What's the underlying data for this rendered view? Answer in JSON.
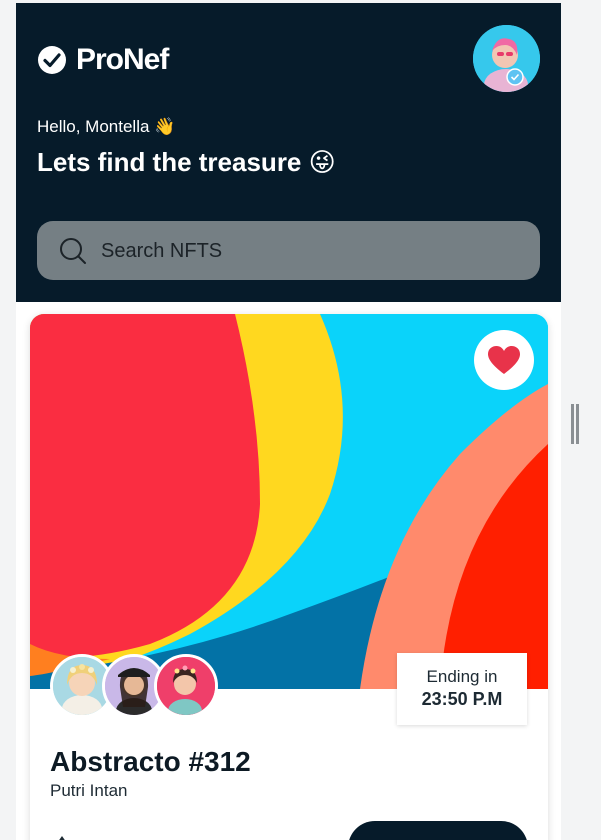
{
  "app": {
    "name": "ProNef"
  },
  "header": {
    "greeting": "Hello, Montella 👋",
    "headline": "Lets find the treasure 😜"
  },
  "search": {
    "placeholder": "Search NFTS",
    "value": ""
  },
  "nft_card": {
    "name": "Abstracto #312",
    "creator": "Putri Intan",
    "ending_label": "Ending in",
    "ending_time": "23:50 P.M",
    "liked": true
  },
  "colors": {
    "header_bg": "#061b2a",
    "search_bg": "#757f84",
    "like_red": "#e8334a",
    "accent_dark": "#061b2a"
  },
  "icons": [
    "check-logo-icon",
    "search-icon",
    "heart-icon",
    "verified-badge-icon",
    "ethereum-icon"
  ]
}
